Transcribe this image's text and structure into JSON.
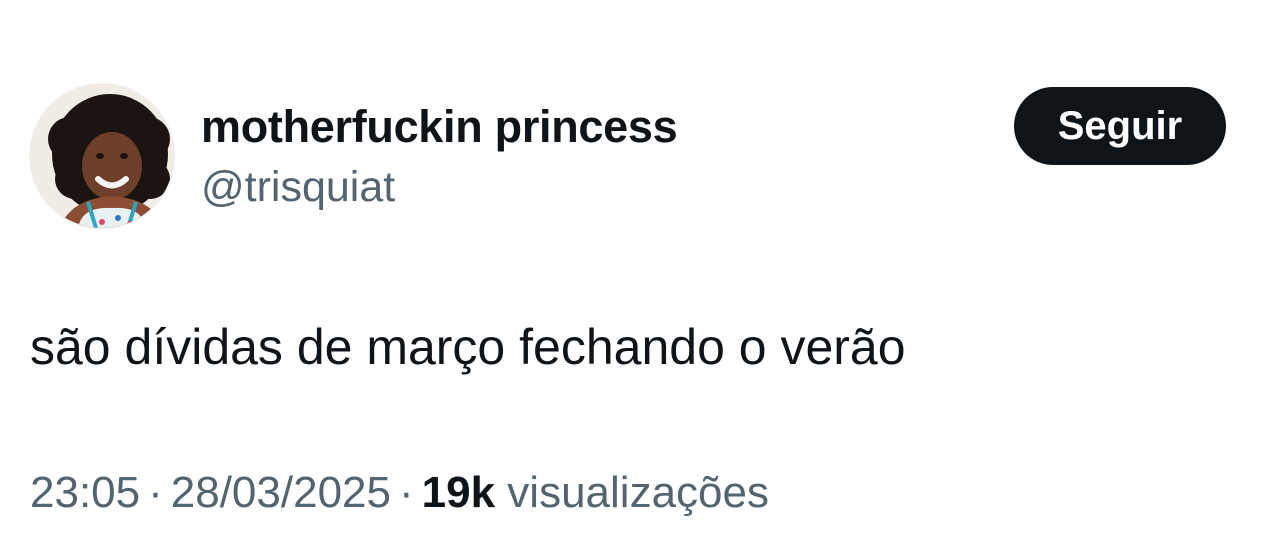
{
  "tweet": {
    "author": {
      "display_name": "motherfuckin princess",
      "handle": "@trisquiat",
      "avatar_icon": "profile-photo"
    },
    "follow_label": "Seguir",
    "text": "são dívidas de março fechando o verão",
    "meta": {
      "time": "23:05",
      "separator": "·",
      "date": "28/03/2025",
      "views_count": "19k",
      "views_label": "visualizações"
    }
  },
  "colors": {
    "text_primary": "#0f1419",
    "text_secondary": "#536471",
    "button_bg": "#0f1419",
    "button_text": "#ffffff",
    "background": "#ffffff"
  }
}
